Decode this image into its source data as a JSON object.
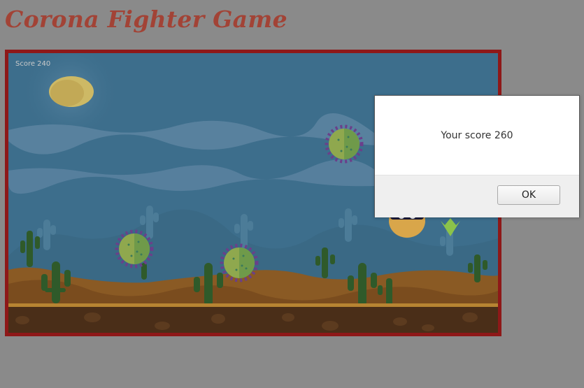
{
  "page": {
    "title": "Corona Fighter Game"
  },
  "game": {
    "score_label": "Score 240",
    "colors": {
      "frame_border": "#8e1818",
      "sky": "#3d6e8c",
      "sand": "#8a5a24",
      "ground": "#4a2e18",
      "cactus": "#2f5a2a"
    },
    "sprites": [
      "sun",
      "virus",
      "virus",
      "virus",
      "player",
      "cactus",
      "cloud",
      "rocket-flame"
    ]
  },
  "dialog": {
    "message": "Your score 260",
    "ok_label": "OK"
  }
}
